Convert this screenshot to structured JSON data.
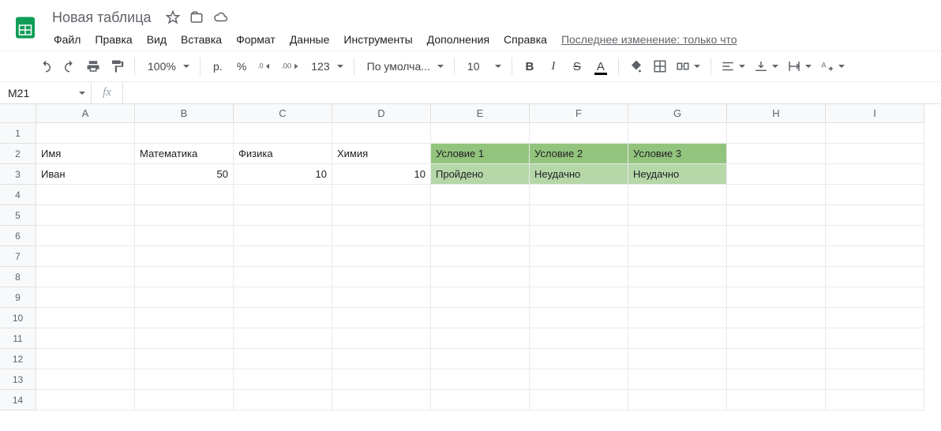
{
  "doc": {
    "title": "Новая таблица",
    "last_edit": "Последнее изменение: только что"
  },
  "menus": [
    "Файл",
    "Правка",
    "Вид",
    "Вставка",
    "Формат",
    "Данные",
    "Инструменты",
    "Дополнения",
    "Справка"
  ],
  "toolbar": {
    "zoom": "100%",
    "currency": "р.",
    "percent": "%",
    "dec_minus": ".0",
    "dec_plus": ".00",
    "more_formats": "123",
    "font": "По умолча...",
    "font_size": "10"
  },
  "namebox": {
    "ref": "M21",
    "formula": ""
  },
  "columns": [
    "A",
    "B",
    "C",
    "D",
    "E",
    "F",
    "G",
    "H",
    "I"
  ],
  "row_count": 14,
  "highlight": {
    "header_color": "#93c47d",
    "body_color": "#b6d7a8"
  },
  "cells": {
    "A2": "Имя",
    "B2": "Математика",
    "C2": "Физика",
    "D2": "Химия",
    "E2": "Условие 1",
    "F2": "Условие 2",
    "G2": "Условие 3",
    "A3": "Иван",
    "B3": "50",
    "C3": "10",
    "D3": "10",
    "E3": "Пройдено",
    "F3": "Неудачно",
    "G3": "Неудачно"
  }
}
